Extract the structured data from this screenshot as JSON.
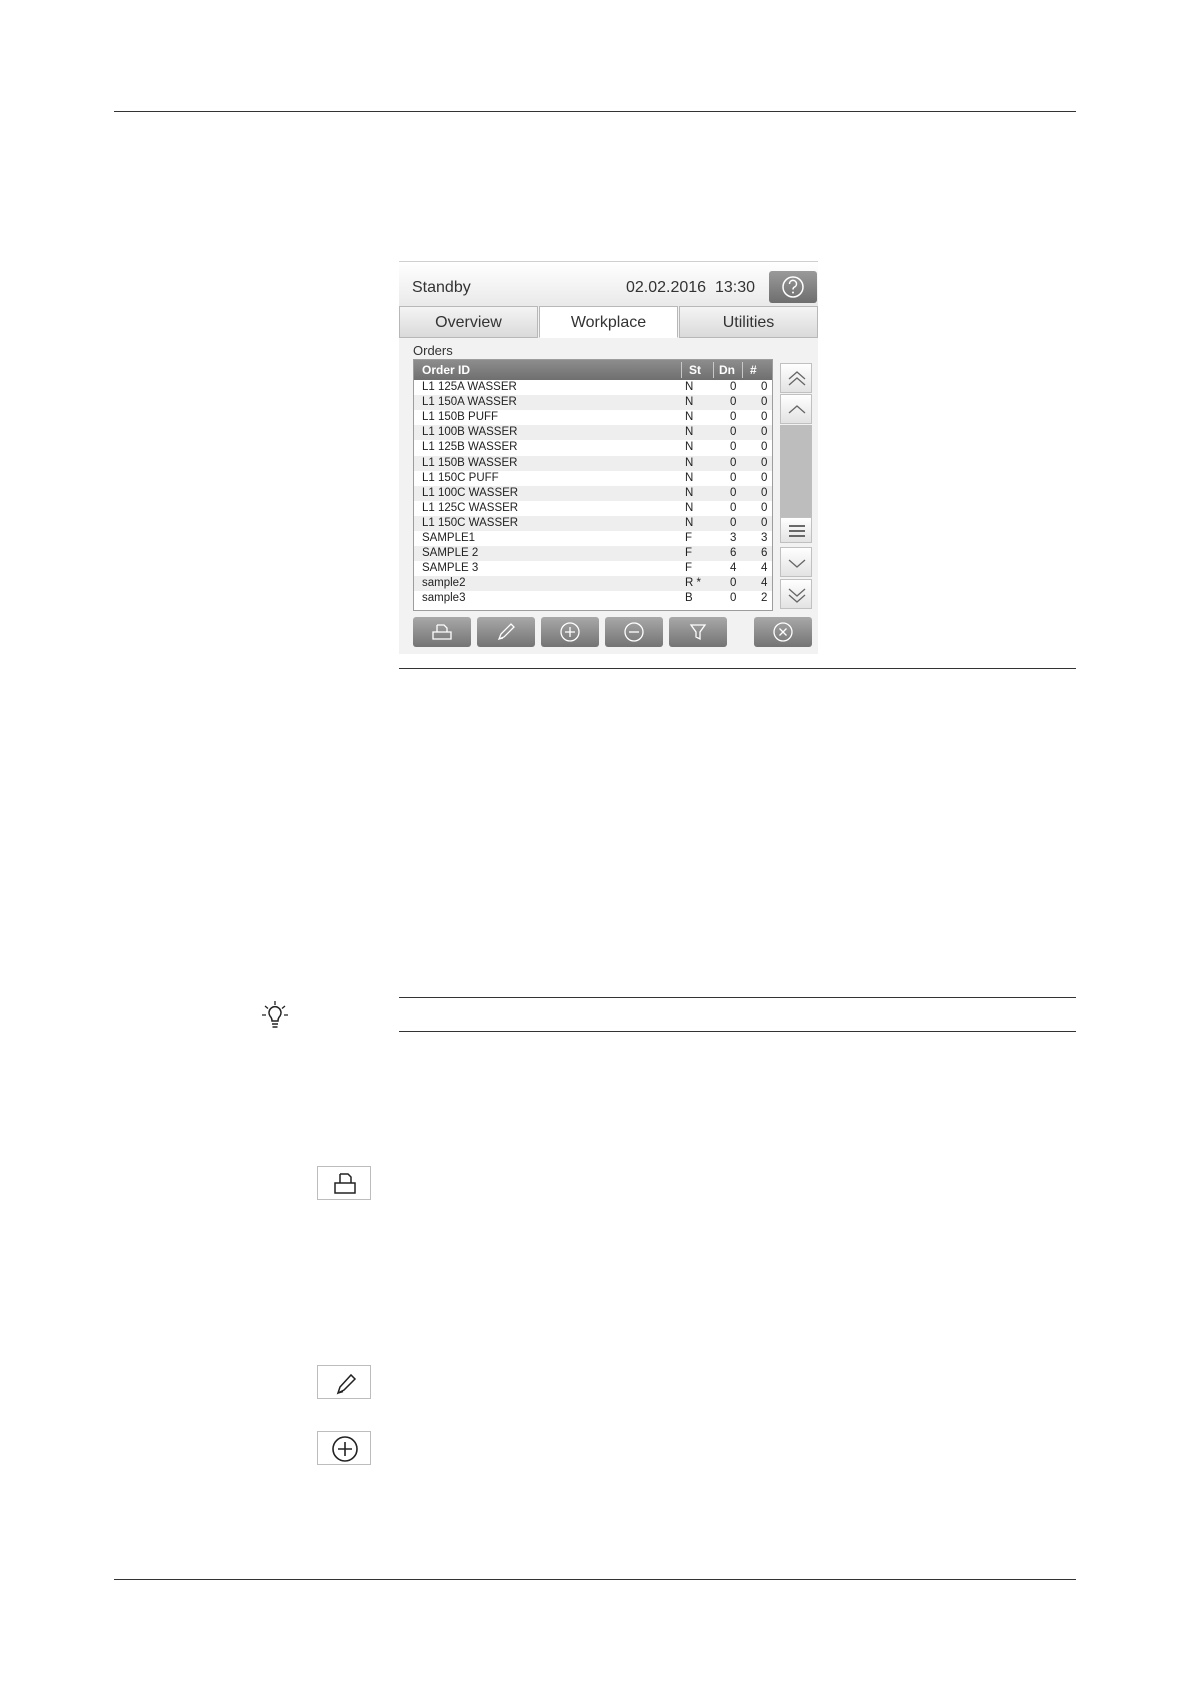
{
  "status_bar": {
    "status": "Standby",
    "date": "02.02.2016",
    "time": "13:30"
  },
  "tabs": [
    {
      "label": "Overview",
      "active": false
    },
    {
      "label": "Workplace",
      "active": true
    },
    {
      "label": "Utilities",
      "active": false
    }
  ],
  "orders": {
    "label": "Orders",
    "columns": [
      "Order ID",
      "St",
      "Dn",
      "#"
    ],
    "rows": [
      {
        "id": "L1 125A WASSER",
        "st": "N",
        "dn": "0",
        "count": "0"
      },
      {
        "id": "L1 150A WASSER",
        "st": "N",
        "dn": "0",
        "count": "0"
      },
      {
        "id": "L1 150B PUFF",
        "st": "N",
        "dn": "0",
        "count": "0"
      },
      {
        "id": "L1 100B WASSER",
        "st": "N",
        "dn": "0",
        "count": "0"
      },
      {
        "id": "L1 125B WASSER",
        "st": "N",
        "dn": "0",
        "count": "0"
      },
      {
        "id": "L1 150B WASSER",
        "st": "N",
        "dn": "0",
        "count": "0"
      },
      {
        "id": "L1 150C PUFF",
        "st": "N",
        "dn": "0",
        "count": "0"
      },
      {
        "id": "L1 100C WASSER",
        "st": "N",
        "dn": "0",
        "count": "0"
      },
      {
        "id": "L1 125C WASSER",
        "st": "N",
        "dn": "0",
        "count": "0"
      },
      {
        "id": "L1 150C WASSER",
        "st": "N",
        "dn": "0",
        "count": "0"
      },
      {
        "id": "SAMPLE1",
        "st": "F",
        "dn": "3",
        "count": "3"
      },
      {
        "id": "SAMPLE 2",
        "st": "F",
        "dn": "6",
        "count": "6"
      },
      {
        "id": "SAMPLE 3",
        "st": "F",
        "dn": "4",
        "count": "4"
      },
      {
        "id": "sample2",
        "st": "R *",
        "dn": "0",
        "count": "4"
      },
      {
        "id": "sample3",
        "st": "B",
        "dn": "0",
        "count": "2"
      }
    ]
  },
  "icons": {
    "help": "help-icon",
    "print": "print-icon",
    "edit": "pencil-icon",
    "add": "plus-circle-icon",
    "remove": "minus-circle-icon",
    "filter": "filter-icon",
    "close": "close-circle-icon",
    "tip": "lightbulb-icon"
  },
  "colors": {
    "header_gray": "#7f7f7f",
    "button_gray": "#8e8e8e"
  }
}
